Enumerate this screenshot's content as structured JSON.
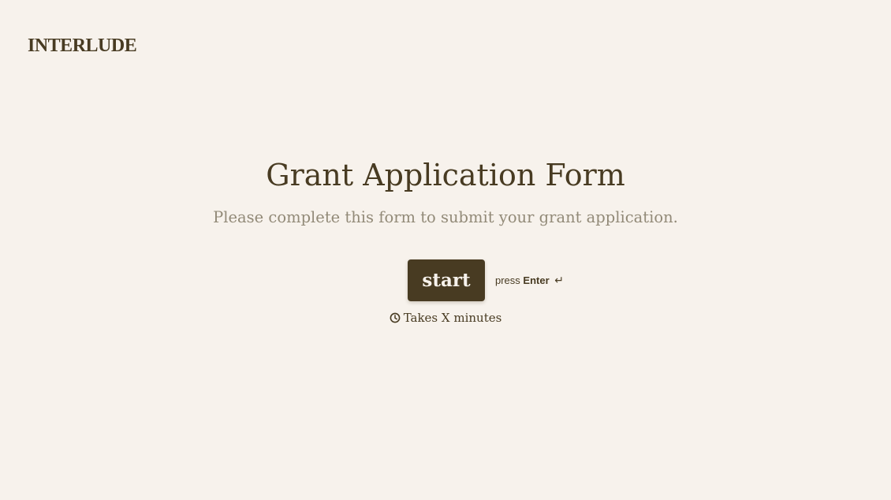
{
  "brand": {
    "logo_text": "INTERLUDE"
  },
  "form": {
    "title": "Grant Application Form",
    "subtitle": "Please complete this form to submit your grant application.",
    "start_label": "start",
    "press_label": "press",
    "enter_key_label": "Enter",
    "enter_icon": "↵",
    "duration_text": "Takes X minutes"
  },
  "icons": {
    "clock": "clock-icon",
    "enter": "enter-key-icon"
  },
  "colors": {
    "background": "#f7f2ec",
    "primary": "#483b22",
    "muted_text": "#928a78",
    "button_text": "#f7f2ec"
  }
}
